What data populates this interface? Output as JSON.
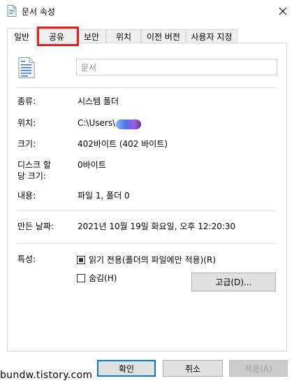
{
  "window": {
    "title": "문서 속성",
    "icon": "document-icon"
  },
  "tabs": [
    {
      "label": "일반",
      "active": true
    },
    {
      "label": "공유",
      "active": false
    },
    {
      "label": "보안",
      "active": false
    },
    {
      "label": "위치",
      "active": false
    },
    {
      "label": "이전 버전",
      "active": false
    },
    {
      "label": "사용자 지정",
      "active": false
    }
  ],
  "general": {
    "folder_name": "문서",
    "fields": {
      "type_label": "종류:",
      "type_value": "시스템 폴더",
      "location_label": "위치:",
      "location_value": "C:\\Users\\",
      "size_label": "크기:",
      "size_value": "402바이트 (402 바이트)",
      "disk_size_label_line1": "디스크 할",
      "disk_size_label_line2": "당 크기:",
      "disk_size_value": "0바이트",
      "contents_label": "내용:",
      "contents_value": "파일 1, 폴더 0",
      "created_label": "만든 날짜:",
      "created_value": "2021년 10월 19일 화요일, 오후 12:20:30",
      "attributes_label": "특성:"
    },
    "attributes": {
      "readonly_label": "읽기 전용(폴더의 파일에만 적용)(R)",
      "readonly_state": "indeterminate",
      "hidden_label": "숨김(H)",
      "hidden_checked": false,
      "advanced_button": "고급(D)..."
    }
  },
  "footer": {
    "ok": "확인",
    "cancel": "취소",
    "apply": "적용(A)"
  },
  "watermark": "bundw.tistory.com",
  "colors": {
    "highlight": "#e0231f",
    "default_button_border": "#0078d7"
  }
}
